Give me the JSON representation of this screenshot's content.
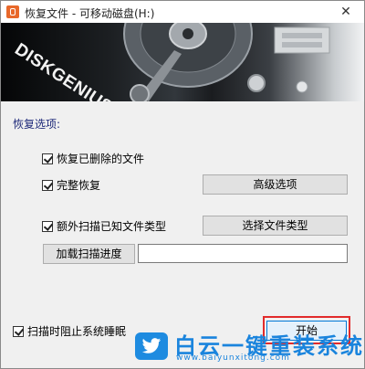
{
  "window": {
    "title": "恢复文件 - 可移动磁盘(H:)",
    "close_glyph": "✕"
  },
  "banner": {
    "brand": "DISKGENIUS"
  },
  "options": {
    "section_title": "恢复选项:",
    "recover_deleted": {
      "label": "恢复已删除的文件",
      "checked": true
    },
    "complete_recovery": {
      "label": "完整恢复",
      "checked": true
    },
    "extra_scan": {
      "label": "额外扫描已知文件类型",
      "checked": true
    },
    "prevent_sleep": {
      "label": "扫描时阻止系统睡眠",
      "checked": true
    }
  },
  "buttons": {
    "advanced": "高级选项",
    "select_types": "选择文件类型",
    "load_progress": "加载扫描进度",
    "start": "开始"
  },
  "load_progress_path": "",
  "watermark": {
    "name": "白云一键重装系统",
    "url": "www.baiyunxitong.com",
    "icon": "twitter-bird-icon"
  },
  "colors": {
    "section_title": "#1f2a7a",
    "highlight": "#e22b2b",
    "watermark": "#1a84dd"
  }
}
